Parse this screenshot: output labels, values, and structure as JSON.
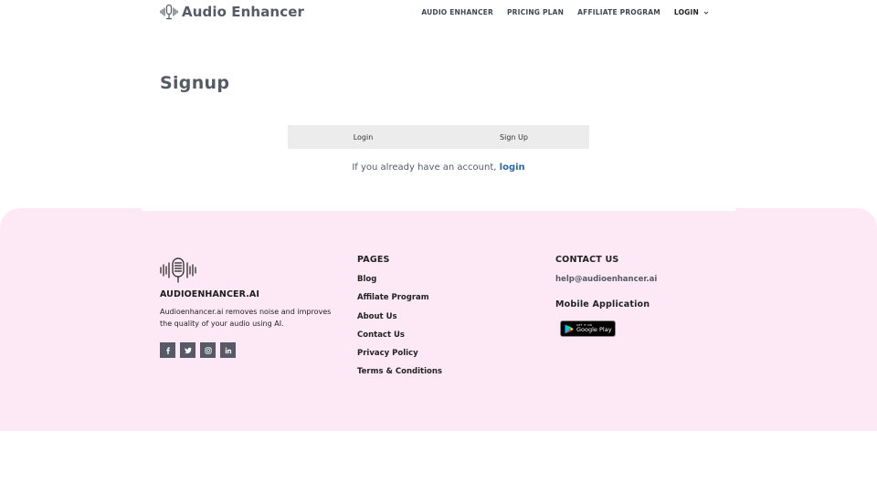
{
  "header": {
    "brand_name": "Audio Enhancer",
    "nav": [
      {
        "label": "AUDIO ENHANCER"
      },
      {
        "label": "PRICING PLAN"
      },
      {
        "label": "AFFILIATE PROGRAM"
      },
      {
        "label": "LOGIN"
      }
    ]
  },
  "main": {
    "page_title": "Signup",
    "tabs": [
      {
        "label": "Login"
      },
      {
        "label": "Sign Up"
      }
    ],
    "account_text": "If you already have an account,",
    "account_link": "login"
  },
  "footer": {
    "brand": "AUDIOENHANCER.AI",
    "description": "Audioenhancer.ai removes noise and improves the quality of your audio using AI.",
    "socials": [
      "facebook-icon",
      "twitter-icon",
      "instagram-icon",
      "linkedin-icon"
    ],
    "pages_heading": "PAGES",
    "pages": [
      {
        "label": "Blog"
      },
      {
        "label": "Affilate Program"
      },
      {
        "label": "About Us"
      },
      {
        "label": "Contact Us"
      },
      {
        "label": "Privacy Policy"
      },
      {
        "label": "Terms & Conditions"
      }
    ],
    "contact_heading": "CONTACT US",
    "email": "help@audioenhancer.ai",
    "mobile_heading": "Mobile Application",
    "play_badge": {
      "small": "GET IT ON",
      "big": "Google Play"
    }
  },
  "colors": {
    "footer_bg": "#fde9f5",
    "link_blue": "#2c6aa8",
    "brand_gray": "#555a66",
    "tab_bg": "#ececec"
  }
}
